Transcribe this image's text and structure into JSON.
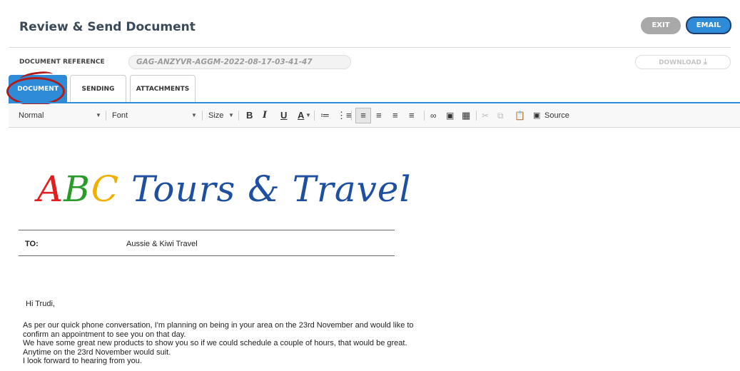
{
  "header": {
    "title": "Review & Send Document",
    "exit_label": "EXIT",
    "email_label": "EMAIL"
  },
  "docref": {
    "label": "DOCUMENT REFERENCE",
    "value": "GAG-ANZYVR-AGGM-2022-08-17-03-41-47",
    "download_label": "DOWNLOAD"
  },
  "tabs": [
    {
      "label": "DOCUMENT"
    },
    {
      "label": "SENDING"
    },
    {
      "label": "ATTACHMENTS"
    }
  ],
  "toolbar": {
    "format_value": "Normal",
    "font_value": "Font",
    "size_value": "Size",
    "bold": "B",
    "italic": "I",
    "underline": "U",
    "color": "A",
    "source_label": "Source"
  },
  "document": {
    "logo": {
      "a": "A",
      "b": "B",
      "c": "C",
      "rest": " Tours & Travel"
    },
    "to_label": "TO:",
    "to_value": "Aussie & Kiwi Travel",
    "greeting": "Hi Trudi,",
    "body": [
      "As per our quick phone conversation, I'm planning on being in your area on the 23rd November and would like to",
      "confirm an appointment to see you on that day.",
      "We have some great new products to show you so if we could schedule a couple of hours, that would be great.",
      "Anytime on the 23rd November would suit.",
      "I look forward to hearing from you."
    ]
  },
  "colors": {
    "accent": "#2e8bd8",
    "exit": "#a9a9a9",
    "highlight": "#b01c1c"
  }
}
